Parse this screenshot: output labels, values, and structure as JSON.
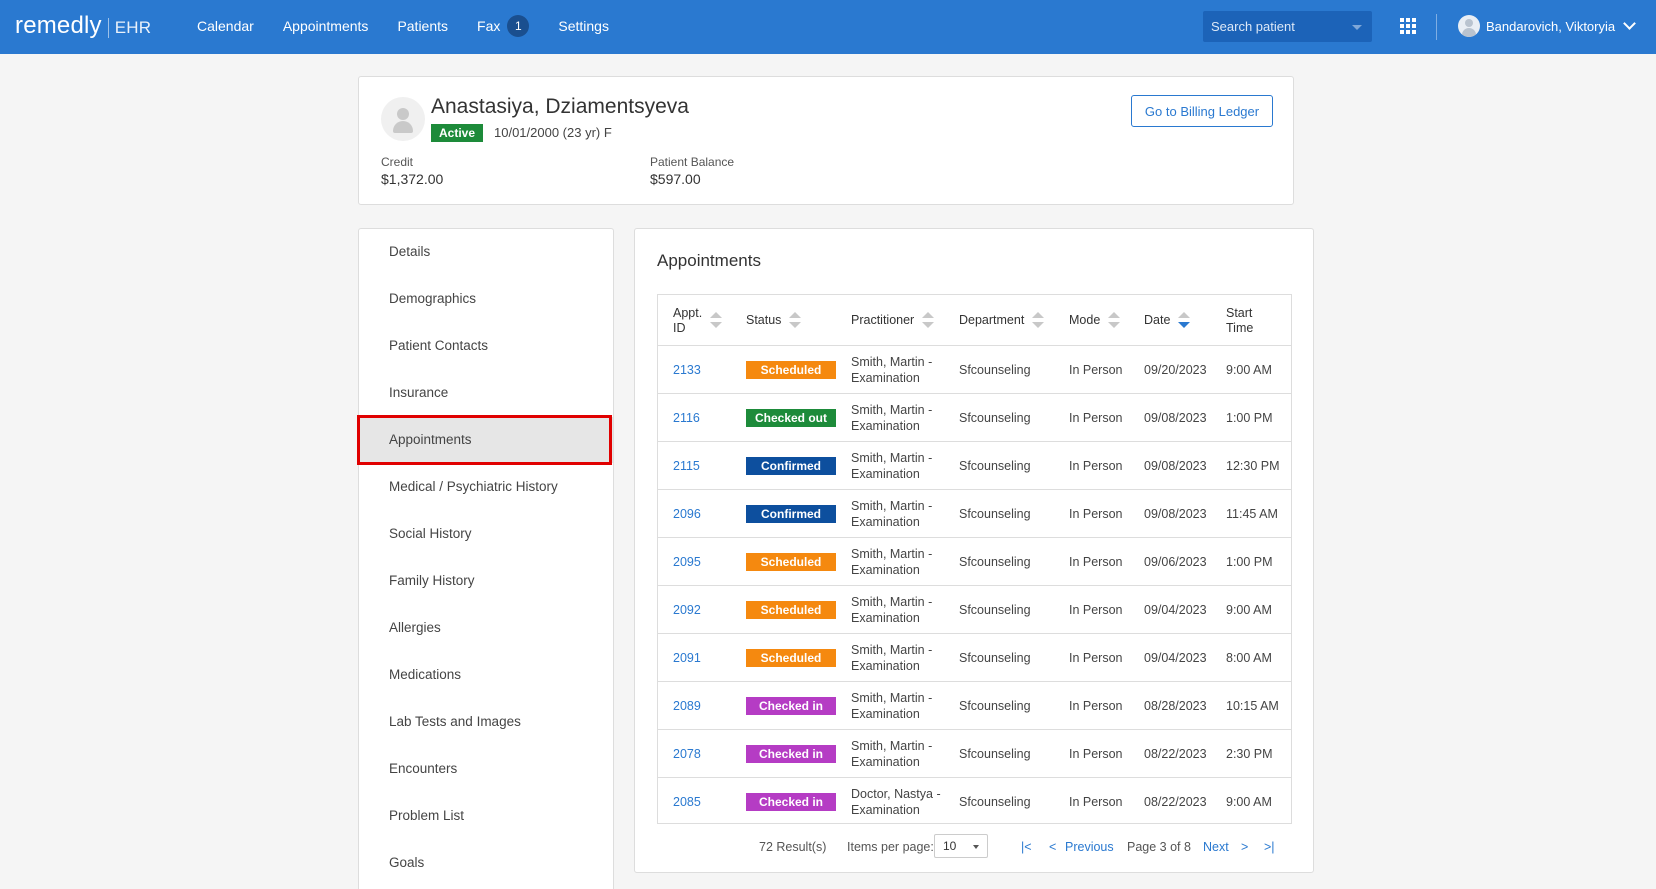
{
  "topbar": {
    "logo_main": "remedly",
    "logo_sub": "EHR",
    "nav": [
      "Calendar",
      "Appointments",
      "Patients",
      "Fax",
      "Settings"
    ],
    "fax_count": "1",
    "search_placeholder": "Search patient",
    "user_name": "Bandarovich, Viktoryia"
  },
  "patient": {
    "name": "Anastasiya, Dziamentsyeva",
    "status": "Active",
    "dob_info": "10/01/2000 (23 yr) F",
    "credit_label": "Credit",
    "credit_value": "$1,372.00",
    "balance_label": "Patient Balance",
    "balance_value": "$597.00",
    "billing_button": "Go to Billing Ledger"
  },
  "sidebar": {
    "items": [
      "Details",
      "Demographics",
      "Patient Contacts",
      "Insurance",
      "Appointments",
      "Medical / Psychiatric History",
      "Social History",
      "Family History",
      "Allergies",
      "Medications",
      "Lab Tests and Images",
      "Encounters",
      "Problem List",
      "Goals"
    ],
    "active": "Appointments"
  },
  "appointments": {
    "title": "Appointments",
    "columns": {
      "id_line1": "Appt.",
      "id_line2": "ID",
      "status": "Status",
      "practitioner": "Practitioner",
      "department": "Department",
      "mode": "Mode",
      "date": "Date",
      "time_line1": "Start",
      "time_line2": "Time"
    },
    "rows": [
      {
        "id": "2133",
        "status": "Scheduled",
        "p1": "Smith, Martin -",
        "p2": "Examination",
        "dept": "Sfcounseling",
        "mode": "In Person",
        "date": "09/20/2023",
        "time": "9:00 AM"
      },
      {
        "id": "2116",
        "status": "Checked out",
        "p1": "Smith, Martin -",
        "p2": "Examination",
        "dept": "Sfcounseling",
        "mode": "In Person",
        "date": "09/08/2023",
        "time": "1:00 PM"
      },
      {
        "id": "2115",
        "status": "Confirmed",
        "p1": "Smith, Martin -",
        "p2": "Examination",
        "dept": "Sfcounseling",
        "mode": "In Person",
        "date": "09/08/2023",
        "time": "12:30 PM"
      },
      {
        "id": "2096",
        "status": "Confirmed",
        "p1": "Smith, Martin -",
        "p2": "Examination",
        "dept": "Sfcounseling",
        "mode": "In Person",
        "date": "09/08/2023",
        "time": "11:45 AM"
      },
      {
        "id": "2095",
        "status": "Scheduled",
        "p1": "Smith, Martin -",
        "p2": "Examination",
        "dept": "Sfcounseling",
        "mode": "In Person",
        "date": "09/06/2023",
        "time": "1:00 PM"
      },
      {
        "id": "2092",
        "status": "Scheduled",
        "p1": "Smith, Martin -",
        "p2": "Examination",
        "dept": "Sfcounseling",
        "mode": "In Person",
        "date": "09/04/2023",
        "time": "9:00 AM"
      },
      {
        "id": "2091",
        "status": "Scheduled",
        "p1": "Smith, Martin -",
        "p2": "Examination",
        "dept": "Sfcounseling",
        "mode": "In Person",
        "date": "09/04/2023",
        "time": "8:00 AM"
      },
      {
        "id": "2089",
        "status": "Checked in",
        "p1": "Smith, Martin -",
        "p2": "Examination",
        "dept": "Sfcounseling",
        "mode": "In Person",
        "date": "08/28/2023",
        "time": "10:15 AM"
      },
      {
        "id": "2078",
        "status": "Checked in",
        "p1": "Smith, Martin -",
        "p2": "Examination",
        "dept": "Sfcounseling",
        "mode": "In Person",
        "date": "08/22/2023",
        "time": "2:30 PM"
      },
      {
        "id": "2085",
        "status": "Checked in",
        "p1": "Doctor, Nastya -",
        "p2": "Examination",
        "dept": "Sfcounseling",
        "mode": "In Person",
        "date": "08/22/2023",
        "time": "9:00 AM"
      }
    ],
    "status_colors": {
      "Scheduled": "#f5890f",
      "Checked out": "#1d8b3a",
      "Confirmed": "#0d4f9e",
      "Checked in": "#b53cc4"
    },
    "pager": {
      "results": "72 Result(s)",
      "items_per_page_label": "Items per page:",
      "items_per_page": "10",
      "first": "|<",
      "prev_arrow": "<",
      "previous": "Previous",
      "page_info": "Page 3 of 8",
      "next": "Next",
      "next_arrow": ">",
      "last": ">|"
    }
  }
}
